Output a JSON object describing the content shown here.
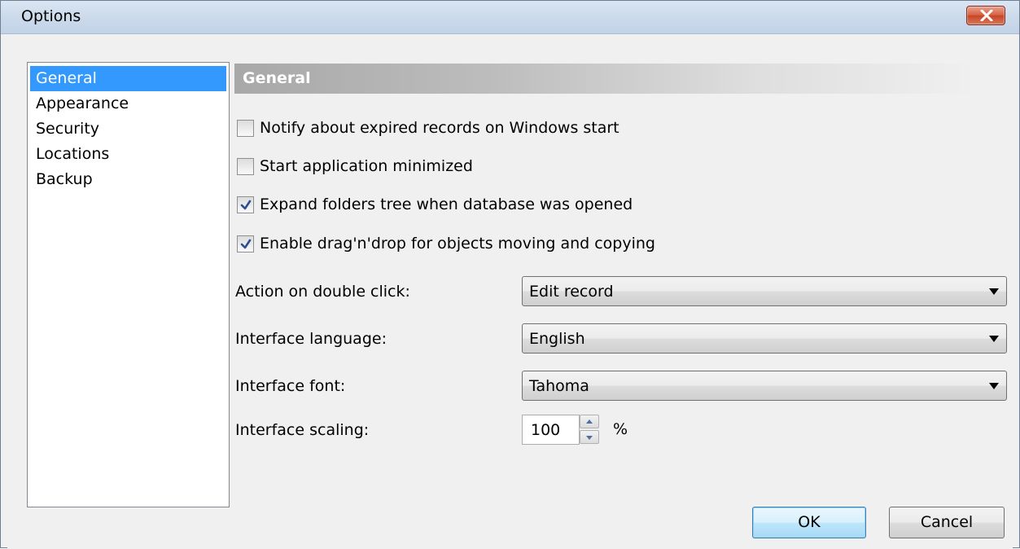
{
  "window": {
    "title": "Options"
  },
  "sidebar": {
    "items": [
      {
        "label": "General"
      },
      {
        "label": "Appearance"
      },
      {
        "label": "Security"
      },
      {
        "label": "Locations"
      },
      {
        "label": "Backup"
      }
    ],
    "selected": "General"
  },
  "section": {
    "title": "General"
  },
  "options": [
    {
      "label": "Notify about expired records on Windows start",
      "checked": false
    },
    {
      "label": "Start application minimized",
      "checked": false
    },
    {
      "label": "Expand folders tree when database was opened",
      "checked": true
    },
    {
      "label": "Enable drag'n'drop for objects moving and copying",
      "checked": true
    }
  ],
  "fields": {
    "double_click": {
      "label": "Action on double click:",
      "value": "Edit record"
    },
    "language": {
      "label": "Interface language:",
      "value": "English"
    },
    "font": {
      "label": "Interface font:",
      "value": "Tahoma"
    },
    "scaling": {
      "label": "Interface scaling:",
      "value": "100",
      "unit": "%"
    }
  },
  "buttons": {
    "ok": "OK",
    "cancel": "Cancel"
  },
  "icons": {
    "close": "close-icon",
    "checkmark": "checkmark-icon"
  },
  "colors": {
    "selection": "#3399ff",
    "check": "#2b4f8f",
    "close": "#c7442a"
  }
}
